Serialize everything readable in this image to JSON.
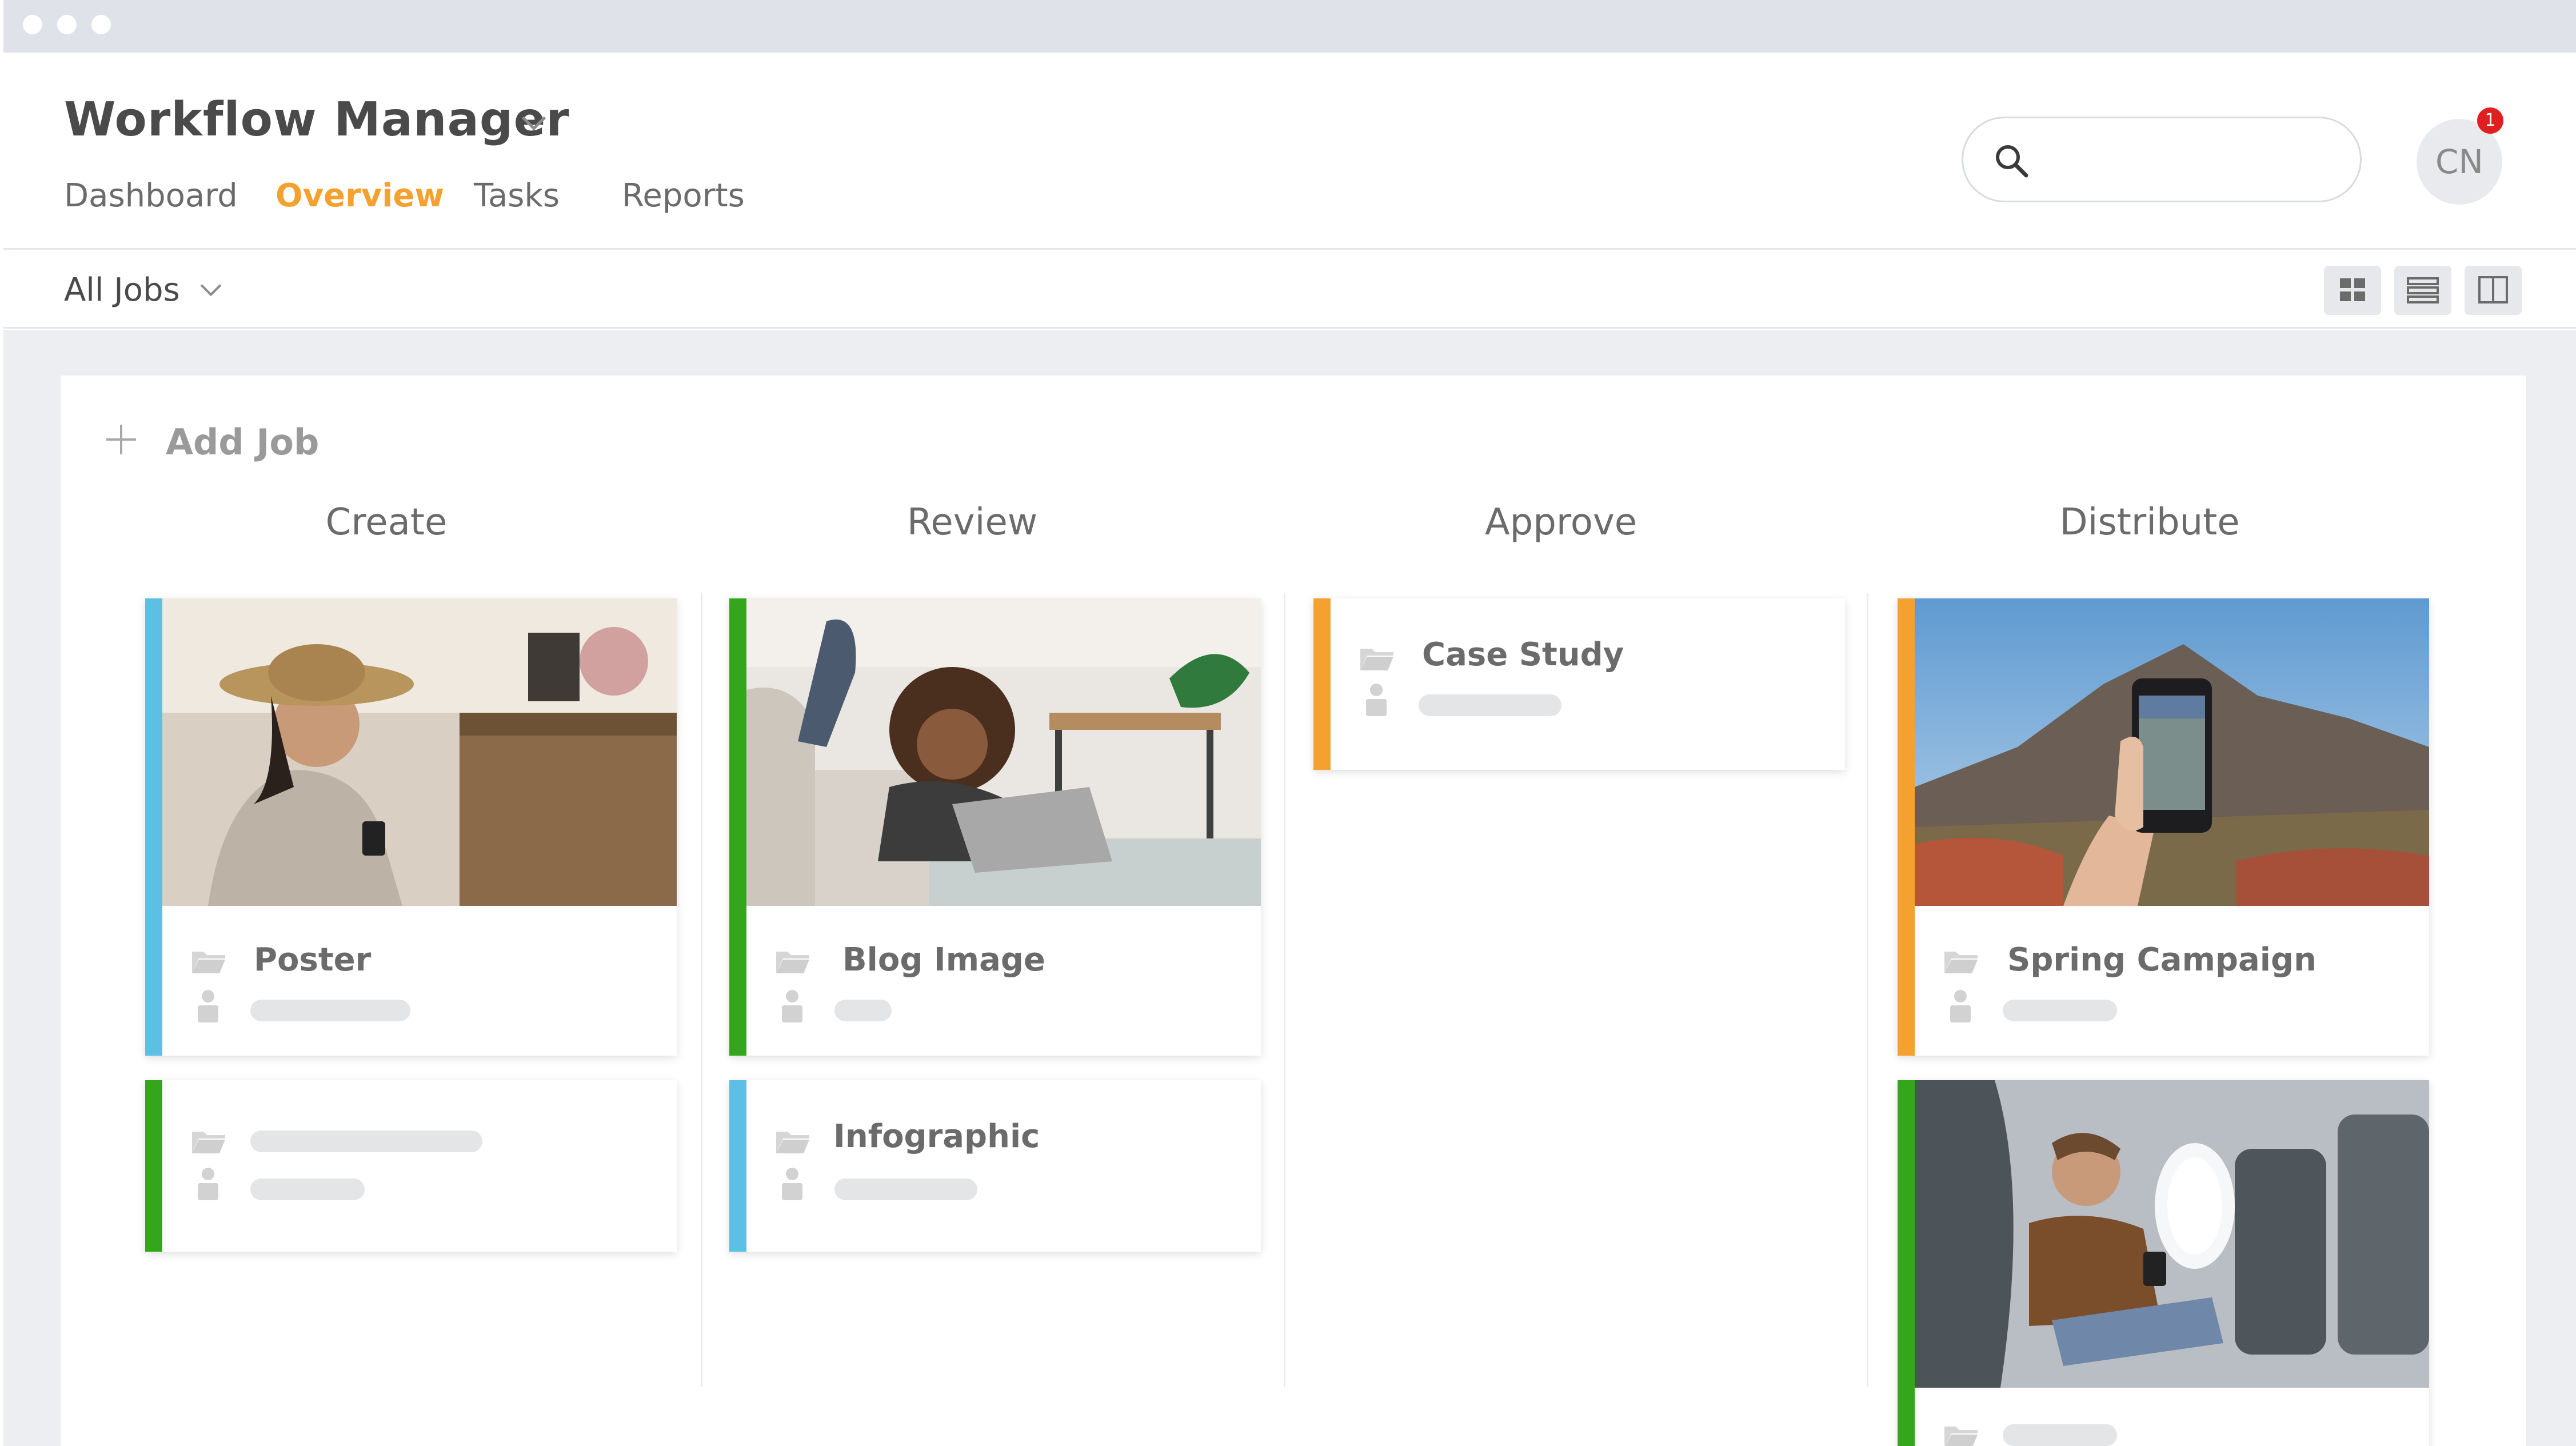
{
  "window": {
    "dots": 3
  },
  "header": {
    "app_title": "Workflow Manager",
    "tabs": [
      {
        "label": "Dashboard",
        "active": false
      },
      {
        "label": "Overview",
        "active": true
      },
      {
        "label": "Tasks",
        "active": false
      },
      {
        "label": "Reports",
        "active": false
      }
    ],
    "search": {
      "placeholder": "",
      "value": ""
    },
    "avatar": {
      "initials": "CN",
      "notification_count": "1"
    }
  },
  "filter": {
    "selected": "All Jobs",
    "view_modes": [
      "grid-view-icon",
      "list-view-icon",
      "columns-view-icon"
    ]
  },
  "board": {
    "add_job_label": "Add Job",
    "columns": [
      {
        "title": "Create",
        "cards": [
          {
            "title": "Poster",
            "stripe_color": "#5bc0e3",
            "has_photo": true,
            "photo": "woman-with-phone-in-cafe"
          },
          {
            "title": "",
            "stripe_color": "#34a61c",
            "has_photo": false
          }
        ]
      },
      {
        "title": "Review",
        "cards": [
          {
            "title": "Blog Image",
            "stripe_color": "#34a61c",
            "has_photo": true,
            "photo": "woman-with-laptop-on-floor"
          },
          {
            "title": "Infographic",
            "stripe_color": "#5bc0e3",
            "has_photo": false
          }
        ]
      },
      {
        "title": "Approve",
        "cards": [
          {
            "title": "Case Study",
            "stripe_color": "#f5a12f",
            "has_photo": false
          }
        ]
      },
      {
        "title": "Distribute",
        "cards": [
          {
            "title": "Spring Campaign",
            "stripe_color": "#f5a12f",
            "has_photo": true,
            "photo": "phone-photographing-mountains"
          },
          {
            "title": "",
            "stripe_color": "#34a61c",
            "has_photo": true,
            "photo": "man-on-airplane-with-phone"
          }
        ]
      }
    ]
  },
  "colors": {
    "accent": "#f5a12f",
    "green": "#34a61c",
    "blue": "#5bc0e3",
    "orange": "#f5a12f",
    "badge": "#e02020"
  }
}
